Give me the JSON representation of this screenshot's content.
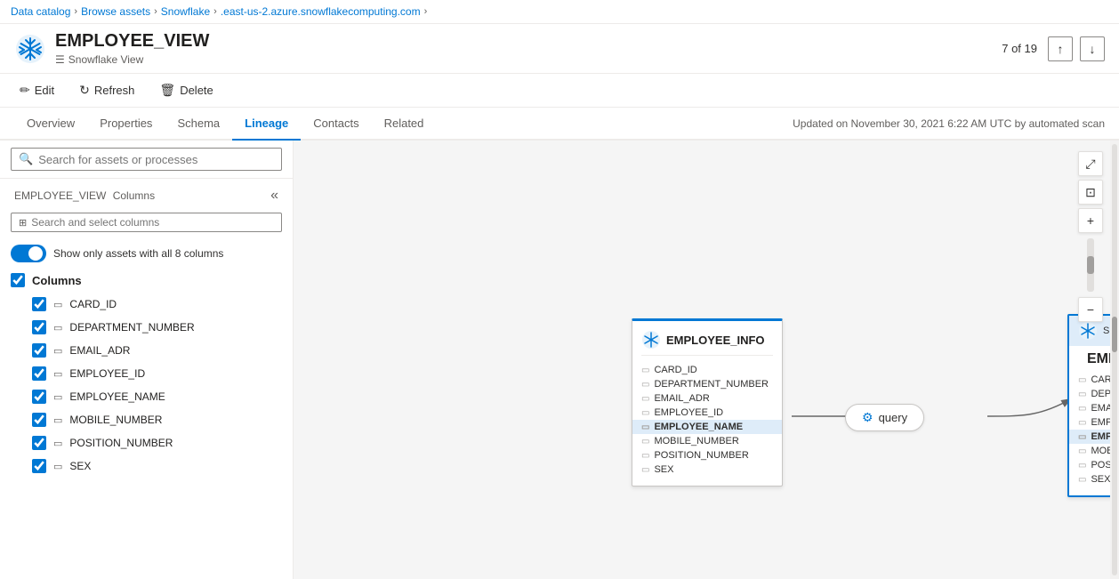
{
  "breadcrumb": {
    "items": [
      {
        "label": "Data catalog",
        "link": true
      },
      {
        "label": "Browse assets",
        "link": true
      },
      {
        "label": "Snowflake",
        "link": true
      },
      {
        "label": ".east-us-2.azure.snowflakecomputing.com",
        "link": true
      }
    ]
  },
  "header": {
    "title": "EMPLOYEE_VIEW",
    "subtitle": "Snowflake View",
    "counter": "7 of 19"
  },
  "toolbar": {
    "edit_label": "Edit",
    "refresh_label": "Refresh",
    "delete_label": "Delete"
  },
  "tabs": {
    "items": [
      "Overview",
      "Properties",
      "Schema",
      "Lineage",
      "Contacts",
      "Related"
    ],
    "active": "Lineage",
    "updated_text": "Updated on November 30, 2021 6:22 AM UTC by automated scan"
  },
  "left_panel": {
    "search_placeholder": "Search for assets or processes",
    "columns_title": "EMPLOYEE_VIEW",
    "columns_label": "Columns",
    "columns_search_placeholder": "Search and select columns",
    "toggle_label": "Show only assets with all 8 columns",
    "columns": [
      {
        "name": "Columns",
        "is_group": true,
        "checked": true
      },
      {
        "name": "CARD_ID",
        "checked": true,
        "highlighted": false
      },
      {
        "name": "DEPARTMENT_NUMBER",
        "checked": true,
        "highlighted": false
      },
      {
        "name": "EMAIL_ADR",
        "checked": true,
        "highlighted": false
      },
      {
        "name": "EMPLOYEE_ID",
        "checked": true,
        "highlighted": false
      },
      {
        "name": "EMPLOYEE_NAME",
        "checked": true,
        "highlighted": false
      },
      {
        "name": "MOBILE_NUMBER",
        "checked": true,
        "highlighted": false
      },
      {
        "name": "POSITION_NUMBER",
        "checked": true,
        "highlighted": false
      },
      {
        "name": "SEX",
        "checked": true,
        "highlighted": false
      }
    ]
  },
  "lineage": {
    "source_node": {
      "title": "EMPLOYEE_INFO",
      "fields": [
        "CARD_ID",
        "DEPARTMENT_NUMBER",
        "EMAIL_ADR",
        "EMPLOYEE_ID",
        "EMPLOYEE_NAME",
        "MOBILE_NUMBER",
        "POSITION_NUMBER",
        "SEX"
      ],
      "active_field": "EMPLOYEE_NAME"
    },
    "query_node": {
      "label": "query"
    },
    "target_node": {
      "subtitle": "Snowflake View",
      "title": "EMPLOYEE_VIEW",
      "fields": [
        "CARD_ID",
        "DEPARTMENT_NUMBER",
        "EMAIL_ADR",
        "EMPLOYEE_ID",
        "EMPLOYEE_NAME",
        "MOBILE_NUMBER",
        "POSITION_NUMBER",
        "SEX"
      ],
      "active_field": "EMPLOYEE_NAME"
    }
  },
  "icons": {
    "edit": "✏",
    "refresh": "↻",
    "delete": "🗑",
    "search": "🔍",
    "filter": "⊞",
    "collapse": "«",
    "field": "▭",
    "chevron_up": "↑",
    "chevron_down": "↓",
    "expand": "⤢",
    "fit": "⊡",
    "zoom_in": "+",
    "zoom_out": "−",
    "table_icon": "▭",
    "view_icon": "☰"
  }
}
